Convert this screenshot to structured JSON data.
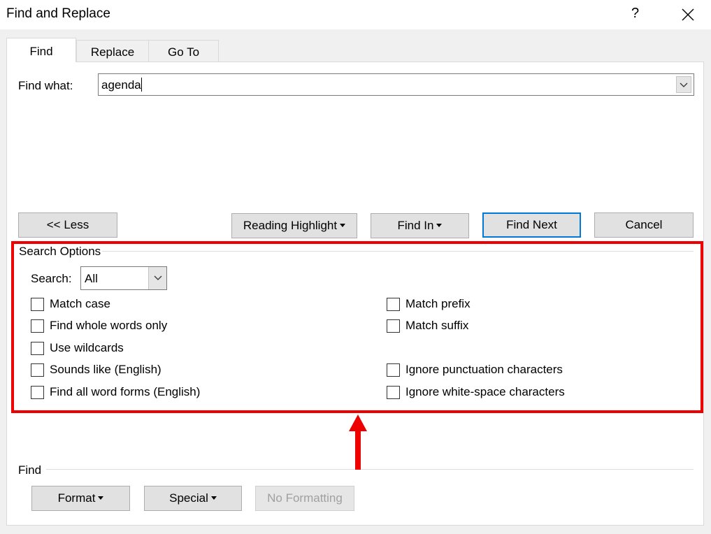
{
  "window": {
    "title": "Find and Replace",
    "help": "?",
    "close": "close"
  },
  "tabs": [
    {
      "label": "Find",
      "active": true
    },
    {
      "label": "Replace",
      "active": false
    },
    {
      "label": "Go To",
      "active": false
    }
  ],
  "find_what": {
    "label": "Find what:",
    "value": "agenda"
  },
  "buttons": {
    "less": "<< Less",
    "reading_highlight": "Reading Highlight",
    "find_in": "Find In",
    "find_next": "Find Next",
    "cancel": "Cancel"
  },
  "search_options": {
    "group_title": "Search Options",
    "search_label": "Search:",
    "search_value": "All",
    "left_options": [
      {
        "label": "Match case",
        "checked": false
      },
      {
        "label": "Find whole words only",
        "checked": false
      },
      {
        "label": "Use wildcards",
        "checked": false
      },
      {
        "label": "Sounds like (English)",
        "checked": false
      },
      {
        "label": "Find all word forms (English)",
        "checked": false
      }
    ],
    "right_options": [
      {
        "label": "Match prefix",
        "checked": false
      },
      {
        "label": "Match suffix",
        "checked": false
      },
      {
        "label": "Ignore punctuation characters",
        "checked": false
      },
      {
        "label": "Ignore white-space characters",
        "checked": false
      }
    ]
  },
  "find_section": {
    "group_title": "Find",
    "format": "Format",
    "special": "Special",
    "no_formatting": "No Formatting"
  },
  "annotation": {
    "color": "#ee0000"
  },
  "icons": {
    "help": "question-mark-icon",
    "close": "close-icon",
    "dropdown": "chevron-down-icon"
  }
}
